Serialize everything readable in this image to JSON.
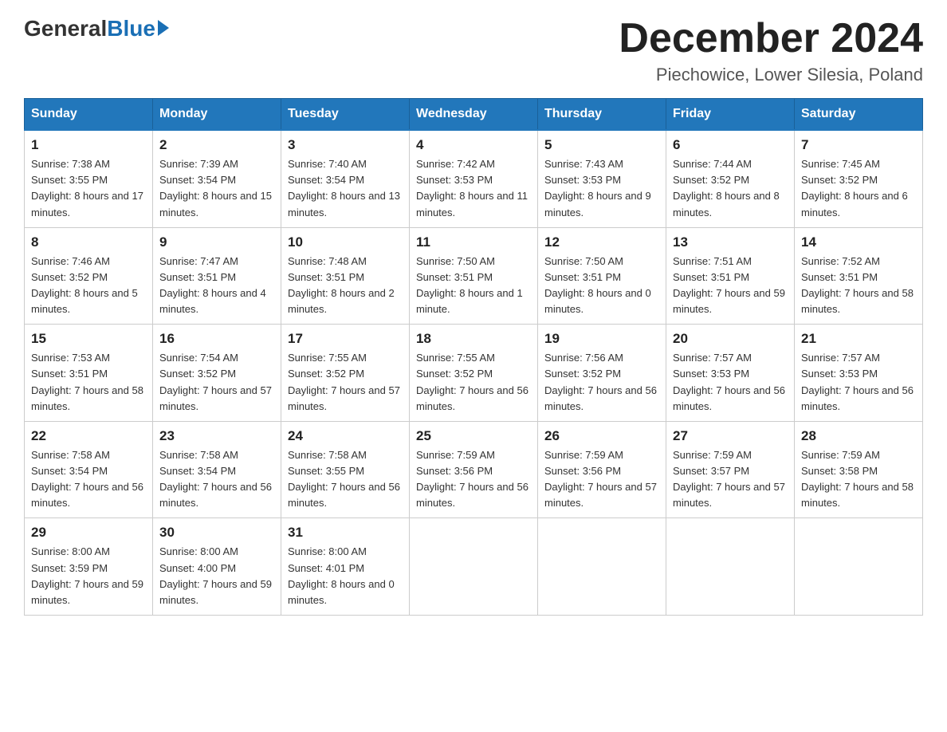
{
  "header": {
    "logo_general": "General",
    "logo_blue": "Blue",
    "month_title": "December 2024",
    "location": "Piechowice, Lower Silesia, Poland"
  },
  "days_of_week": [
    "Sunday",
    "Monday",
    "Tuesday",
    "Wednesday",
    "Thursday",
    "Friday",
    "Saturday"
  ],
  "weeks": [
    [
      {
        "day": "1",
        "sunrise": "7:38 AM",
        "sunset": "3:55 PM",
        "daylight": "8 hours and 17 minutes."
      },
      {
        "day": "2",
        "sunrise": "7:39 AM",
        "sunset": "3:54 PM",
        "daylight": "8 hours and 15 minutes."
      },
      {
        "day": "3",
        "sunrise": "7:40 AM",
        "sunset": "3:54 PM",
        "daylight": "8 hours and 13 minutes."
      },
      {
        "day": "4",
        "sunrise": "7:42 AM",
        "sunset": "3:53 PM",
        "daylight": "8 hours and 11 minutes."
      },
      {
        "day": "5",
        "sunrise": "7:43 AM",
        "sunset": "3:53 PM",
        "daylight": "8 hours and 9 minutes."
      },
      {
        "day": "6",
        "sunrise": "7:44 AM",
        "sunset": "3:52 PM",
        "daylight": "8 hours and 8 minutes."
      },
      {
        "day": "7",
        "sunrise": "7:45 AM",
        "sunset": "3:52 PM",
        "daylight": "8 hours and 6 minutes."
      }
    ],
    [
      {
        "day": "8",
        "sunrise": "7:46 AM",
        "sunset": "3:52 PM",
        "daylight": "8 hours and 5 minutes."
      },
      {
        "day": "9",
        "sunrise": "7:47 AM",
        "sunset": "3:51 PM",
        "daylight": "8 hours and 4 minutes."
      },
      {
        "day": "10",
        "sunrise": "7:48 AM",
        "sunset": "3:51 PM",
        "daylight": "8 hours and 2 minutes."
      },
      {
        "day": "11",
        "sunrise": "7:50 AM",
        "sunset": "3:51 PM",
        "daylight": "8 hours and 1 minute."
      },
      {
        "day": "12",
        "sunrise": "7:50 AM",
        "sunset": "3:51 PM",
        "daylight": "8 hours and 0 minutes."
      },
      {
        "day": "13",
        "sunrise": "7:51 AM",
        "sunset": "3:51 PM",
        "daylight": "7 hours and 59 minutes."
      },
      {
        "day": "14",
        "sunrise": "7:52 AM",
        "sunset": "3:51 PM",
        "daylight": "7 hours and 58 minutes."
      }
    ],
    [
      {
        "day": "15",
        "sunrise": "7:53 AM",
        "sunset": "3:51 PM",
        "daylight": "7 hours and 58 minutes."
      },
      {
        "day": "16",
        "sunrise": "7:54 AM",
        "sunset": "3:52 PM",
        "daylight": "7 hours and 57 minutes."
      },
      {
        "day": "17",
        "sunrise": "7:55 AM",
        "sunset": "3:52 PM",
        "daylight": "7 hours and 57 minutes."
      },
      {
        "day": "18",
        "sunrise": "7:55 AM",
        "sunset": "3:52 PM",
        "daylight": "7 hours and 56 minutes."
      },
      {
        "day": "19",
        "sunrise": "7:56 AM",
        "sunset": "3:52 PM",
        "daylight": "7 hours and 56 minutes."
      },
      {
        "day": "20",
        "sunrise": "7:57 AM",
        "sunset": "3:53 PM",
        "daylight": "7 hours and 56 minutes."
      },
      {
        "day": "21",
        "sunrise": "7:57 AM",
        "sunset": "3:53 PM",
        "daylight": "7 hours and 56 minutes."
      }
    ],
    [
      {
        "day": "22",
        "sunrise": "7:58 AM",
        "sunset": "3:54 PM",
        "daylight": "7 hours and 56 minutes."
      },
      {
        "day": "23",
        "sunrise": "7:58 AM",
        "sunset": "3:54 PM",
        "daylight": "7 hours and 56 minutes."
      },
      {
        "day": "24",
        "sunrise": "7:58 AM",
        "sunset": "3:55 PM",
        "daylight": "7 hours and 56 minutes."
      },
      {
        "day": "25",
        "sunrise": "7:59 AM",
        "sunset": "3:56 PM",
        "daylight": "7 hours and 56 minutes."
      },
      {
        "day": "26",
        "sunrise": "7:59 AM",
        "sunset": "3:56 PM",
        "daylight": "7 hours and 57 minutes."
      },
      {
        "day": "27",
        "sunrise": "7:59 AM",
        "sunset": "3:57 PM",
        "daylight": "7 hours and 57 minutes."
      },
      {
        "day": "28",
        "sunrise": "7:59 AM",
        "sunset": "3:58 PM",
        "daylight": "7 hours and 58 minutes."
      }
    ],
    [
      {
        "day": "29",
        "sunrise": "8:00 AM",
        "sunset": "3:59 PM",
        "daylight": "7 hours and 59 minutes."
      },
      {
        "day": "30",
        "sunrise": "8:00 AM",
        "sunset": "4:00 PM",
        "daylight": "7 hours and 59 minutes."
      },
      {
        "day": "31",
        "sunrise": "8:00 AM",
        "sunset": "4:01 PM",
        "daylight": "8 hours and 0 minutes."
      },
      null,
      null,
      null,
      null
    ]
  ]
}
